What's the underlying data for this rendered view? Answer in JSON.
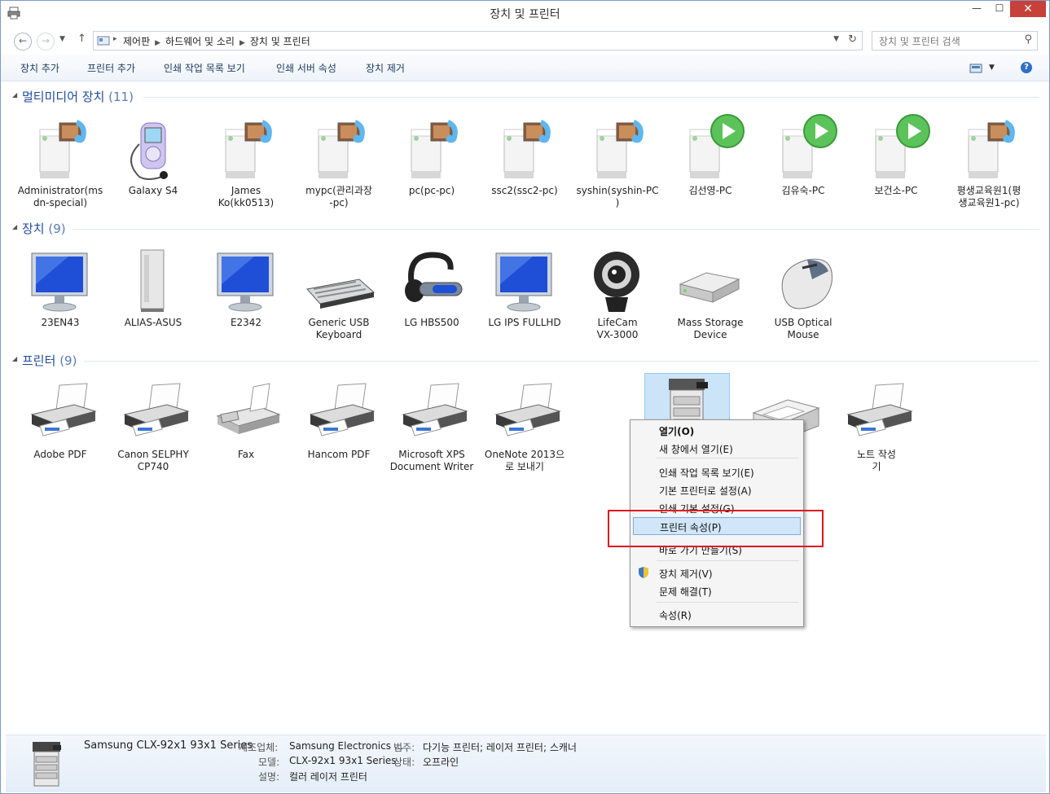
{
  "window": {
    "title": "장치 및 프린터",
    "minimize": "—",
    "maximize": "☐",
    "close": "✕"
  },
  "address": {
    "crumbs": [
      "제어판",
      "하드웨어 및 소리",
      "장치 및 프린터"
    ],
    "search_placeholder": "장치 및 프린터 검색"
  },
  "commands": [
    "장치 추가",
    "프린터 추가",
    "인쇄 작업 목록 보기",
    "인쇄 서버 속성",
    "장치 제거"
  ],
  "groups": [
    {
      "title": "멀티미디어 장치",
      "count": "(11)",
      "items": [
        {
          "label": "Administrator(ms\ndn-special)",
          "icon": "media-server-icon"
        },
        {
          "label": "Galaxy S4",
          "icon": "media-player-icon"
        },
        {
          "label": "James\nKo(kk0513)",
          "icon": "media-server-icon"
        },
        {
          "label": "mypc(관리과장\n-pc)",
          "icon": "media-server-icon"
        },
        {
          "label": "pc(pc-pc)",
          "icon": "media-server-icon"
        },
        {
          "label": "ssc2(ssc2-pc)",
          "icon": "media-server-icon"
        },
        {
          "label": "syshin(syshin-PC\n)",
          "icon": "media-server-icon"
        },
        {
          "label": "김선영-PC",
          "icon": "media-renderer-icon"
        },
        {
          "label": "김유숙-PC",
          "icon": "media-renderer-icon"
        },
        {
          "label": "보건소-PC",
          "icon": "media-renderer-icon"
        },
        {
          "label": "평생교육원1(평\n생교육원1-pc)",
          "icon": "media-server-icon"
        }
      ]
    },
    {
      "title": "장치",
      "count": "(9)",
      "items": [
        {
          "label": "23EN43",
          "icon": "monitor-icon"
        },
        {
          "label": "ALIAS-ASUS",
          "icon": "pc-tower-icon"
        },
        {
          "label": "E2342",
          "icon": "monitor-icon"
        },
        {
          "label": "Generic USB\nKeyboard",
          "icon": "keyboard-icon"
        },
        {
          "label": "LG HBS500",
          "icon": "headset-icon"
        },
        {
          "label": "LG IPS FULLHD",
          "icon": "monitor-icon"
        },
        {
          "label": "LifeCam\nVX-3000",
          "icon": "webcam-icon"
        },
        {
          "label": "Mass Storage\nDevice",
          "icon": "drive-icon"
        },
        {
          "label": "USB Optical\nMouse",
          "icon": "mouse-icon"
        }
      ]
    },
    {
      "title": "프린터",
      "count": "(9)",
      "items": [
        {
          "label": "Adobe PDF",
          "icon": "printer-icon"
        },
        {
          "label": "Canon SELPHY\nCP740",
          "icon": "printer-icon"
        },
        {
          "label": "Fax",
          "icon": "fax-icon"
        },
        {
          "label": "Hancom PDF",
          "icon": "printer-icon"
        },
        {
          "label": "Microsoft XPS\nDocument Writer",
          "icon": "printer-icon"
        },
        {
          "label": "OneNote 2013으\n로 보내기",
          "icon": "printer-icon"
        },
        {
          "label": "Samsung\nCLX-92x1 93x1\nSeries",
          "icon": "copier-icon"
        },
        {
          "label": "",
          "icon": "laser-printer-icon"
        },
        {
          "label": "노트 작성\n기",
          "icon": "printer-icon"
        }
      ]
    }
  ],
  "context_menu": {
    "items": [
      "열기(O)",
      "새 창에서 열기(E)",
      "인쇄 작업 목록 보기(E)",
      "기본 프린터로 설정(A)",
      "인쇄 기본 설정(G)",
      "프린터 속성(P)",
      "바로 가기 만들기(S)",
      "장치 제거(V)",
      "문제 해결(T)",
      "속성(R)"
    ],
    "highlighted": "프린터 속성(P)"
  },
  "status": {
    "name": "Samsung CLX-92x1 93x1 Series",
    "manufacturer_label": "제조업체:",
    "manufacturer": "Samsung Electronics ...",
    "category_label": "범주:",
    "category": "다기능 프린터; 레이저 프린터; 스캐너",
    "model_label": "모델:",
    "model": "CLX-92x1 93x1 Series",
    "state_label": "상태:",
    "state": "오프라인",
    "desc_label": "설명:",
    "desc": "컬러 레이저 프린터"
  },
  "colors": {
    "accent": "#1e4b9b",
    "close": "#c7403a",
    "highlight": "#e0181e"
  }
}
